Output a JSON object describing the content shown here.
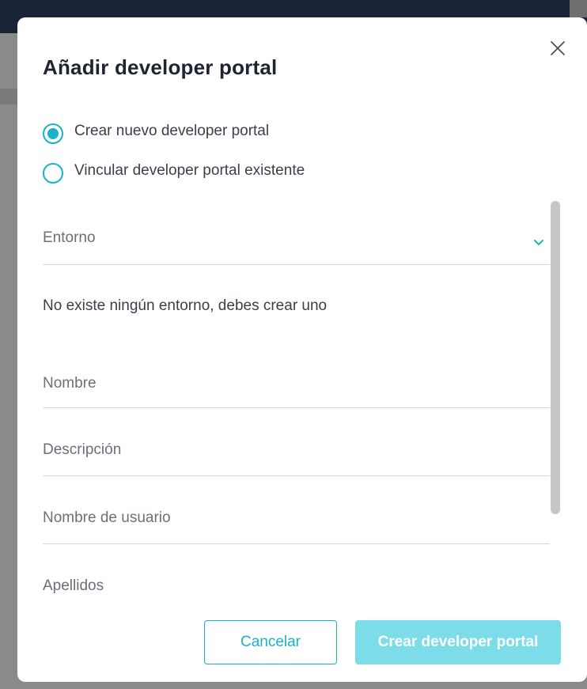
{
  "dialog": {
    "title": "Añadir developer portal",
    "options": [
      {
        "label": "Crear nuevo developer portal",
        "selected": true
      },
      {
        "label": "Vincular developer portal existente",
        "selected": false
      }
    ],
    "fields": {
      "entorno": {
        "label": "Entorno",
        "icon": "chevron-down-icon"
      },
      "info_message": "No existe ningún entorno, debes crear uno",
      "nombre": {
        "label": "Nombre"
      },
      "descripcion": {
        "label": "Descripción"
      },
      "usuario": {
        "label": "Nombre de usuario"
      },
      "apellidos": {
        "label": "Apellidos"
      }
    },
    "buttons": {
      "cancel": "Cancelar",
      "create": "Crear developer portal"
    },
    "colors": {
      "accent": "#19b2c9",
      "primary_disabled": "#7cdde9",
      "title": "#1f2433"
    },
    "close_icon": "close-icon"
  }
}
